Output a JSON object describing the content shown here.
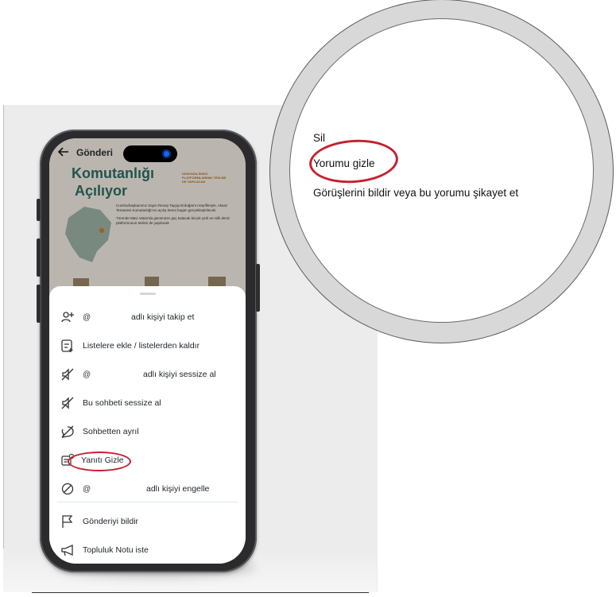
{
  "post_header": {
    "title": "Gönderi"
  },
  "background_post": {
    "headline_line1": "Komutanlığı",
    "headline_line2": "Açılıyor",
    "badge_text": "DÜNYADA İKİNCİ PLATFORMLARININ TESLİMİ DE YAPILACAK",
    "bullet_1": "Cumhurbaşkanımız Sayın Recep Tayyip Erdoğan'ın teşrifleriyle, Aksaz Tersanesi Komutanlığı'nın açılış töreni bugün gerçekleştirilecek",
    "bullet_2": "Törende Mavi Vatan'da gücümüze güç katacak birçok yerli ve milli deniz platformunun teslimi de yapılacak"
  },
  "menu": {
    "items": [
      {
        "icon": "follow-user-icon",
        "prefix": "@",
        "label": "adlı kişiyi takip et"
      },
      {
        "icon": "list-icon",
        "prefix": "",
        "label": "Listelere ekle / listelerden kaldır"
      },
      {
        "icon": "mute-icon",
        "prefix": "@",
        "label": "adlı kişiyi sessize al"
      },
      {
        "icon": "mute-icon",
        "prefix": "",
        "label": "Bu sohbeti sessize al"
      },
      {
        "icon": "leave-conversation-icon",
        "prefix": "",
        "label": "Sohbetten ayrıl"
      },
      {
        "icon": "hide-reply-icon",
        "prefix": "",
        "label": "Yanıtı Gizle"
      },
      {
        "icon": "block-icon",
        "prefix": "@",
        "label": "adlı kişiyi engelle"
      },
      {
        "icon": "flag-icon",
        "prefix": "",
        "label": "Gönderiyi bildir"
      },
      {
        "icon": "megaphone-icon",
        "prefix": "",
        "label": "Topluluk Notu iste"
      }
    ]
  },
  "zoom": {
    "item_delete": "Sil",
    "item_hide_comment": "Yorumu gizle",
    "item_report": "Görüşlerini bildir veya bu yorumu şikayet et"
  },
  "colors": {
    "highlight": "#c7202f",
    "accent": "#2f6f66"
  }
}
